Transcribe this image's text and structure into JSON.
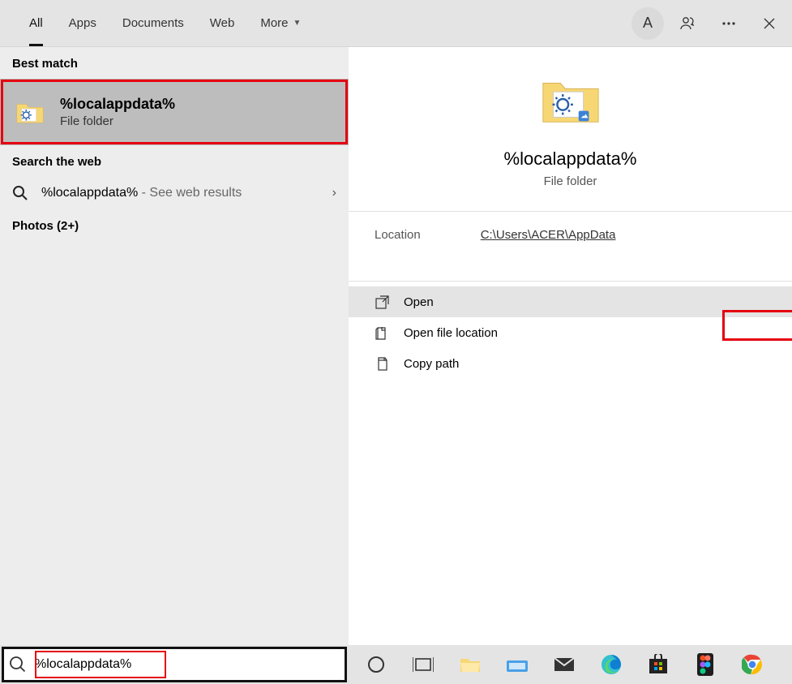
{
  "tabs": {
    "all": "All",
    "apps": "Apps",
    "documents": "Documents",
    "web": "Web",
    "more": "More"
  },
  "avatar": "A",
  "left": {
    "best_match_label": "Best match",
    "bm_title": "%localappdata%",
    "bm_sub": "File folder",
    "search_web_label": "Search the web",
    "web_query": "%localappdata%",
    "web_suffix": " - See web results",
    "photos_label": "Photos (2+)"
  },
  "right": {
    "title": "%localappdata%",
    "sub": "File folder",
    "loc_label": "Location",
    "loc_path": "C:\\Users\\ACER\\AppData",
    "actions": {
      "open": "Open",
      "open_loc": "Open file location",
      "copy_path": "Copy path"
    }
  },
  "search": {
    "value": "%localappdata%"
  }
}
